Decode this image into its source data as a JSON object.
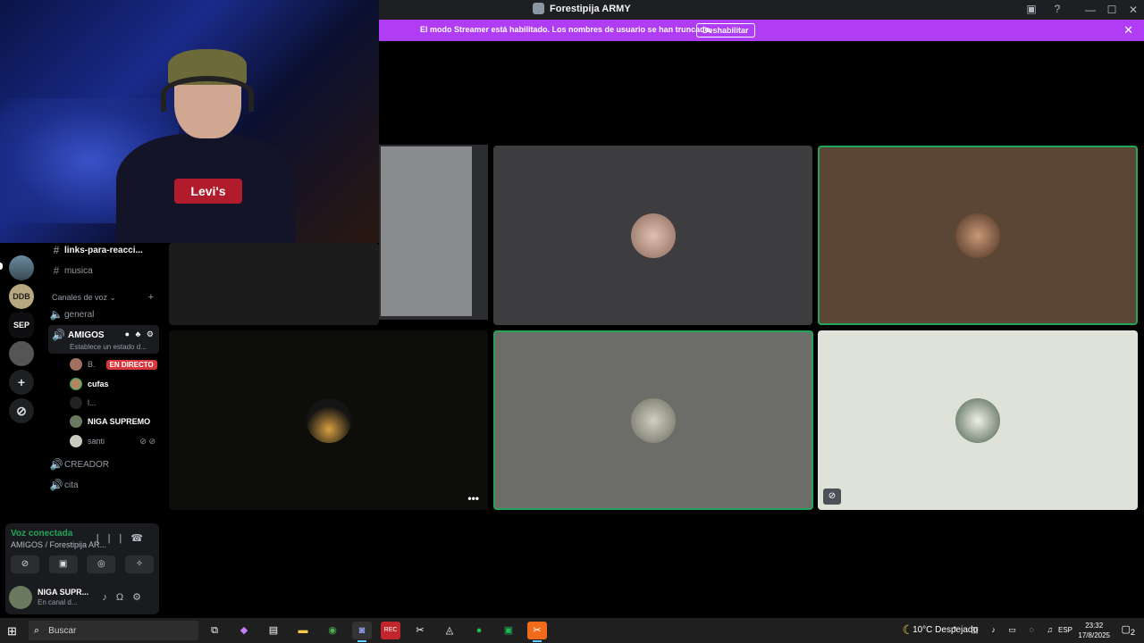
{
  "window": {
    "title": "Forestipija ARMY",
    "controls": [
      "—",
      "☐",
      "✕"
    ]
  },
  "banner": {
    "message": "El modo Streamer está habilitado. Los nombres de usuario se han truncado.",
    "button": "Deshabilitar",
    "close": "✕"
  },
  "webcam": {
    "shirt_logo": "Levi's"
  },
  "servers": [
    {
      "label": "",
      "icon": "server-avatar"
    },
    {
      "label": "DDB",
      "icon": "server-ddb"
    },
    {
      "label": "SEP",
      "icon": "server-sep"
    },
    {
      "label": "",
      "icon": "server-sbc"
    },
    {
      "label": "+",
      "icon": "add-server-icon"
    },
    {
      "label": "⊘",
      "icon": "explore-icon"
    }
  ],
  "channels": {
    "text": [
      {
        "name": "links-para-reacci...",
        "bold": true
      },
      {
        "name": "musica",
        "bold": false
      }
    ],
    "voice_category": "Canales de voz",
    "voice": [
      {
        "name": "general"
      },
      {
        "name": "AMIGOS",
        "status": "Establece un estado d..."
      },
      {
        "name": "CREADOR"
      },
      {
        "name": "cita"
      }
    ],
    "members": [
      {
        "name": "B.",
        "live": "EN DIRECTO",
        "bold": false
      },
      {
        "name": "cufas",
        "bold": true
      },
      {
        "name": "l...",
        "bold": false
      },
      {
        "name": "NIGA SUPREMO",
        "bold": true
      },
      {
        "name": "santi",
        "bold": false
      }
    ]
  },
  "voice_panel": {
    "status": "Voz conectada",
    "channel": "AMIGOS / Forestipija AR..."
  },
  "user": {
    "name": "NIGA SUPR...",
    "status": "En canal d..."
  },
  "grid": {
    "more_icon": "•••"
  },
  "taskbar": {
    "search_placeholder": "Buscar",
    "weather": "10°C  Despejado",
    "lang": "ESP",
    "time": "23:32",
    "date": "17/8/2025",
    "notifications": "2"
  }
}
